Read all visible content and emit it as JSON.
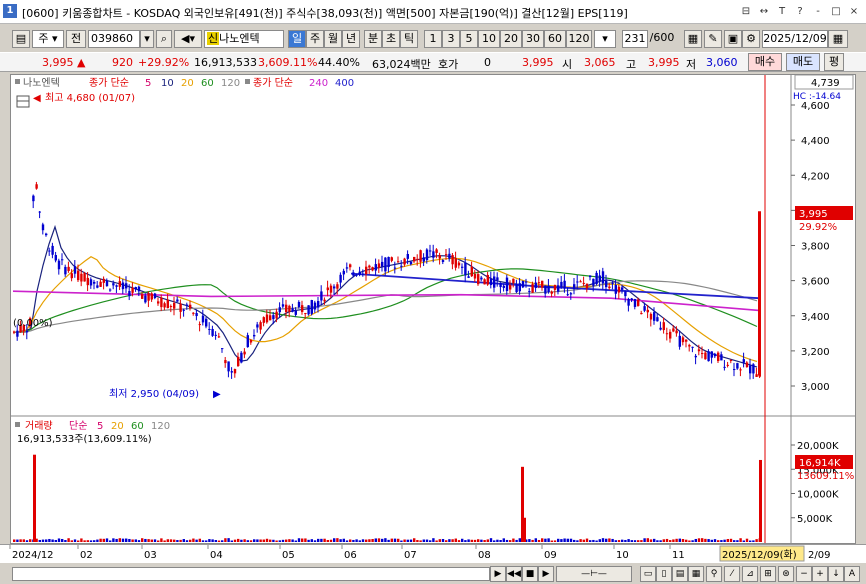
{
  "titlebar": {
    "title": "[0600] 키움종합차트 - KOSDAQ 외국인보유[491(천)] 주식수[38,093(천)] 액면[500] 자본금[190(억)] 결산[12월] EPS[119]",
    "app_number": "1",
    "buttons": [
      "⊟",
      "↔",
      "T",
      "?",
      "-",
      "□",
      "×"
    ]
  },
  "toolbar": {
    "market_label": "주",
    "prev_label": "전",
    "code": "039860",
    "shin_label": "신",
    "name": "나노엔텍",
    "periods": [
      "일",
      "주",
      "월",
      "년",
      "분",
      "초",
      "틱"
    ],
    "minutes": [
      "1",
      "3",
      "5",
      "10",
      "20",
      "30",
      "60",
      "120"
    ],
    "count": "231",
    "count_total": "/600",
    "date": "2025/12/09"
  },
  "quote": {
    "price": "3,995",
    "arrow": "▲",
    "change": "920",
    "change_pct": "+29.92%",
    "volume": "16,913,533",
    "vol_ratio": "3,609.11%",
    "turnover": "44.40%",
    "amount": "63,024백만",
    "hoga_label": "호가",
    "hoga_value": "0",
    "hoga_price": "3,995",
    "open_label": "시",
    "open": "3,065",
    "high_label": "고",
    "high": "3,995",
    "low_label": "저",
    "low": "3,060",
    "buy_label": "매수",
    "sell_label": "매도",
    "flat_label": "평"
  },
  "price_panel": {
    "legend_name": "나노엔텍",
    "legend_ma_label": "종가 단순",
    "legend_ma_periods": [
      "5",
      "10",
      "20",
      "60",
      "120"
    ],
    "legend_ma_long_label": "종가 단순",
    "legend_ma_long_periods": [
      "240",
      "400"
    ],
    "max_label": "최고 4,680 (01/07)",
    "min_label": "최저 2,950 (04/09)",
    "pct_label": "(0.00%)",
    "y_ticks": [
      "4,600",
      "4,400",
      "4,200",
      "4,000",
      "3,800",
      "3,600",
      "3,400",
      "3,200",
      "3,000"
    ],
    "y_top_value": "4,739",
    "hc_label": "HC :-14.64",
    "price_tag": "3,995",
    "price_tag_pct": "29.92%"
  },
  "volume_panel": {
    "legend_label": "거래량",
    "legend_ma_label": "단순",
    "legend_ma_periods": [
      "5",
      "20",
      "60",
      "120"
    ],
    "volume_text": "16,913,533주(13,609.11%)",
    "y_ticks": [
      "20,000K",
      "15,000K",
      "10,000K",
      "5,000K"
    ],
    "vol_tag": "16,914K",
    "vol_tag2": "13609.11%"
  },
  "x_axis": {
    "labels": [
      "2024/12",
      "02",
      "03",
      "04",
      "05",
      "06",
      "07",
      "08",
      "09",
      "10",
      "11"
    ],
    "current_date": "2025/12/09(화)",
    "trail": "2/09"
  },
  "colors": {
    "up": "#e00000",
    "down": "#0000d0",
    "ma5": "#d4006a",
    "ma10": "#1a237e",
    "ma20": "#e6a000",
    "ma60": "#1f8f1f",
    "ma120": "#888888",
    "ma240": "#cc22cc",
    "ma400": "#2222cc"
  }
}
